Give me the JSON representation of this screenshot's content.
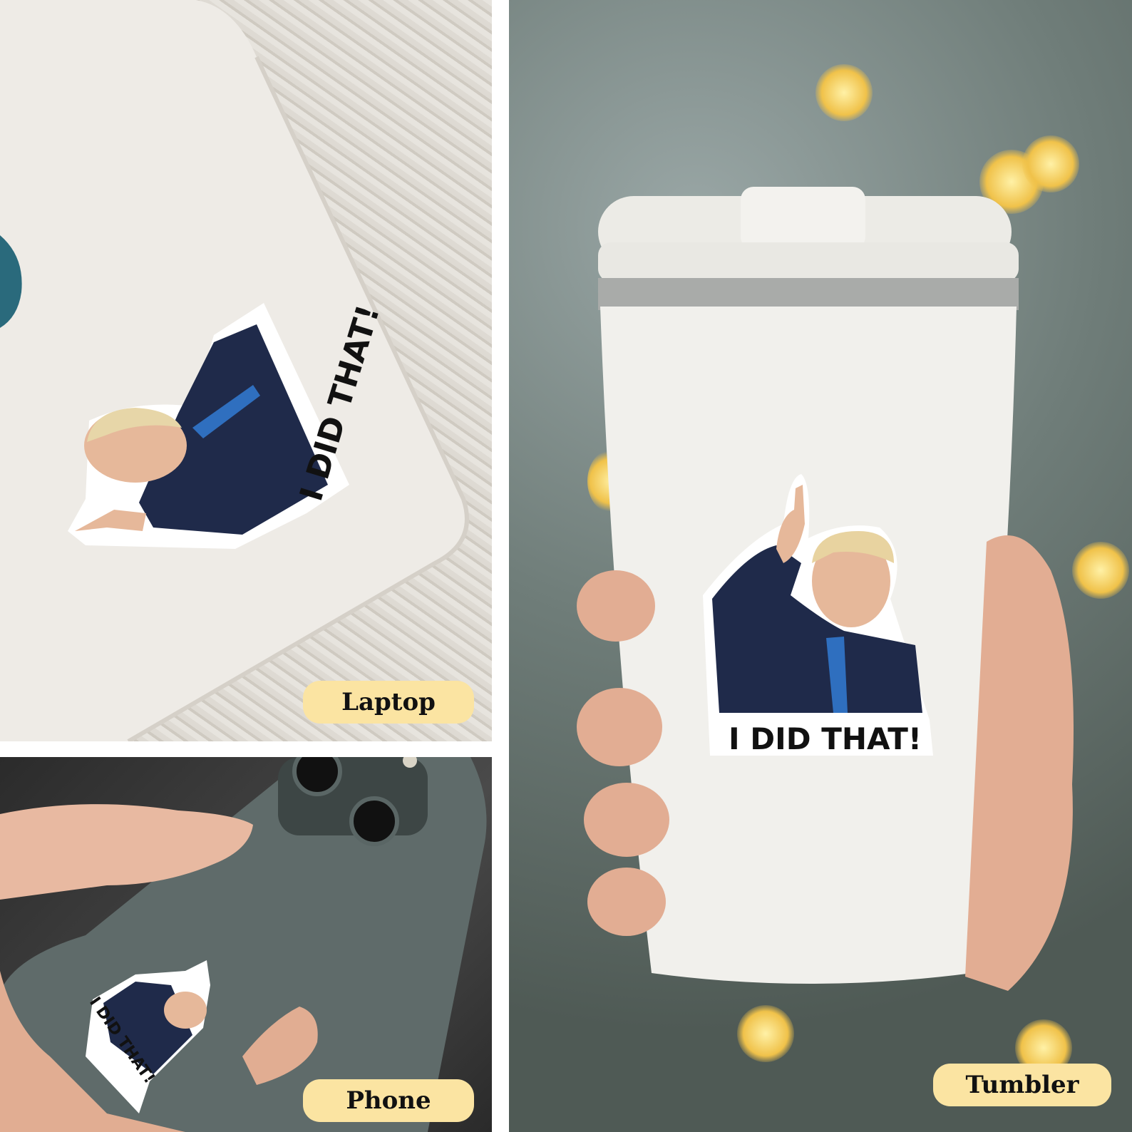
{
  "labels": {
    "laptop": "Laptop",
    "phone": "Phone",
    "tumbler": "Tumbler"
  },
  "sticker": {
    "caption": "I DID THAT!"
  },
  "colors": {
    "label_bg": "#fbe4a2",
    "suit": "#1f2a4a",
    "tie": "#2f6fbf"
  }
}
